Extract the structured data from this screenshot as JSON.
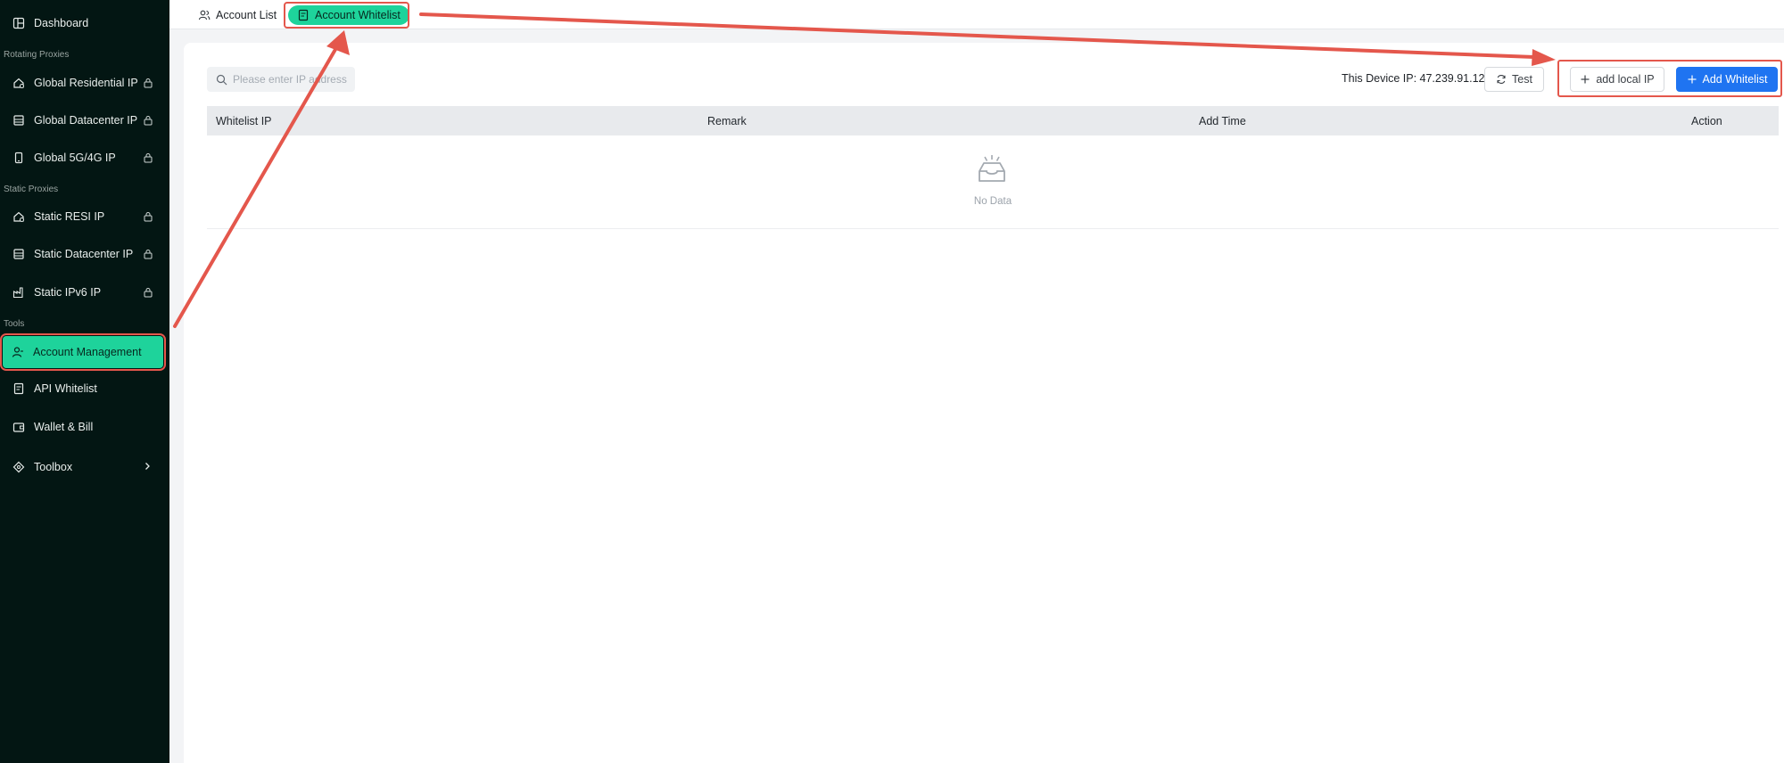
{
  "sidebar": {
    "dashboard": "Dashboard",
    "section_rotating": "Rotating Proxies",
    "global_residential": "Global Residential IP",
    "global_datacenter": "Global Datacenter IP",
    "global_5g4g": "Global 5G/4G IP",
    "section_static": "Static Proxies",
    "static_resi": "Static RESI IP",
    "static_datacenter": "Static Datacenter IP",
    "static_ipv6": "Static IPv6 IP",
    "section_tools": "Tools",
    "account_management": "Account Management",
    "api_whitelist": "API Whitelist",
    "wallet_bill": "Wallet & Bill",
    "toolbox": "Toolbox"
  },
  "tabs": {
    "account_list": "Account List",
    "account_whitelist": "Account Whitelist"
  },
  "toolbar": {
    "search_placeholder": "Please enter IP address",
    "device_ip_label": "This Device IP: 47.239.91.123",
    "test_button": "Test",
    "add_local_ip_button": "add local IP",
    "add_whitelist_button": "Add Whitelist"
  },
  "table": {
    "columns": [
      "Whitelist IP",
      "Remark",
      "Add Time",
      "Action"
    ],
    "empty_text": "No Data"
  },
  "colors": {
    "sidebar_bg": "#031613",
    "accent_green": "#1ed39b",
    "primary_blue": "#1f74f1",
    "annotation_red": "#e4574c"
  }
}
